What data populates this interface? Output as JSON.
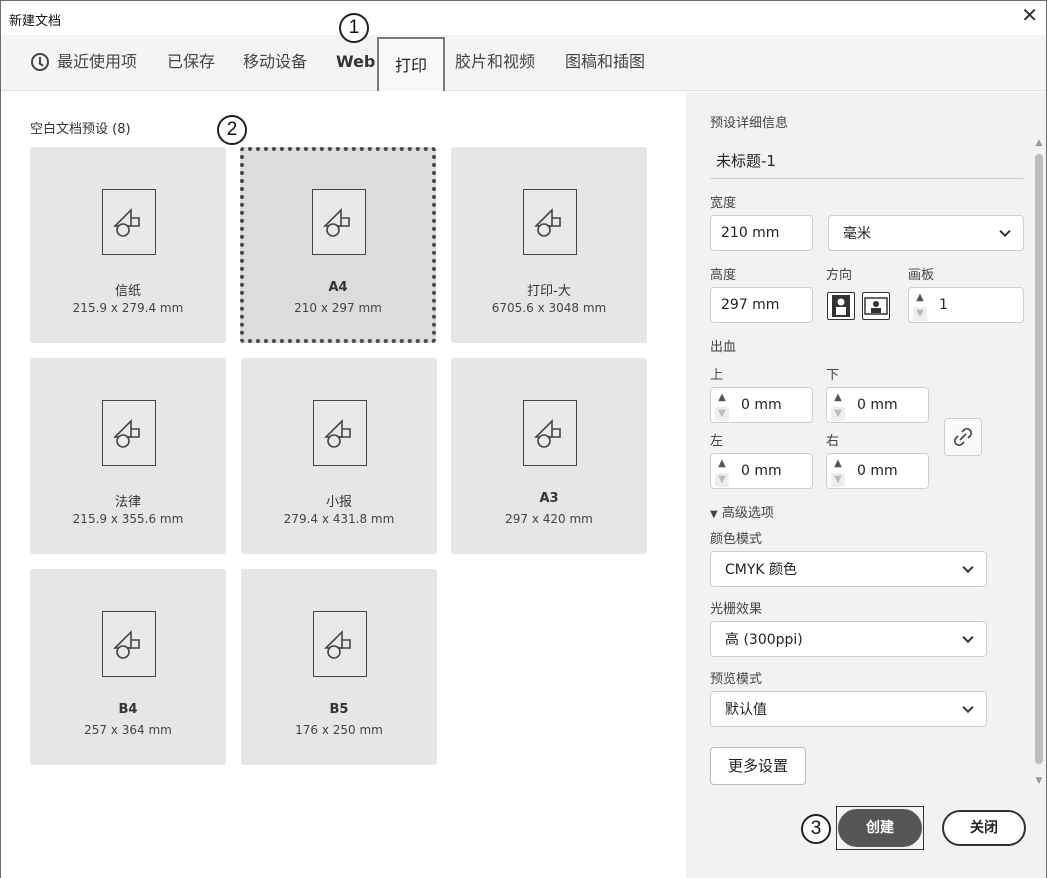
{
  "window": {
    "title": "新建文档",
    "close_glyph": "✕"
  },
  "tabs": {
    "recent": "最近使用项",
    "saved": "已保存",
    "mobile": "移动设备",
    "web": "Web",
    "print": "打印",
    "film": "胶片和视频",
    "art": "图稿和插图"
  },
  "callouts": {
    "one": "1",
    "two": "2",
    "three": "3"
  },
  "presets": {
    "title": "空白文档预设 (8)",
    "cards": [
      {
        "name": "信纸",
        "size": "215.9 x 279.4 mm"
      },
      {
        "name": "A4",
        "size": "210 x 297 mm"
      },
      {
        "name": "打印-大",
        "size": "6705.6 x 3048 mm"
      },
      {
        "name": "法律",
        "size": "215.9 x 355.6 mm"
      },
      {
        "name": "小报",
        "size": "279.4 x 431.8 mm"
      },
      {
        "name": "A3",
        "size": "297 x 420 mm"
      },
      {
        "name": "B4",
        "size": "257 x 364 mm"
      },
      {
        "name": "B5",
        "size": "176 x 250 mm"
      }
    ]
  },
  "details": {
    "header": "预设详细信息",
    "doc_name": "未标题-1",
    "width_label": "宽度",
    "width_value": "210 mm",
    "unit_value": "毫米",
    "height_label": "高度",
    "height_value": "297 mm",
    "orientation_label": "方向",
    "artboards_label": "画板",
    "artboards_value": "1",
    "bleed_label": "出血",
    "top_label": "上",
    "top_value": "0 mm",
    "bottom_label": "下",
    "bottom_value": "0 mm",
    "left_label": "左",
    "left_value": "0 mm",
    "right_label": "右",
    "right_value": "0 mm",
    "advanced_label": "高级选项",
    "color_mode_label": "颜色模式",
    "color_mode_value": "CMYK 颜色",
    "raster_label": "光栅效果",
    "raster_value": "高 (300ppi)",
    "preview_label": "预览模式",
    "preview_value": "默认值",
    "more_settings": "更多设置",
    "create": "创建",
    "close": "关闭"
  }
}
